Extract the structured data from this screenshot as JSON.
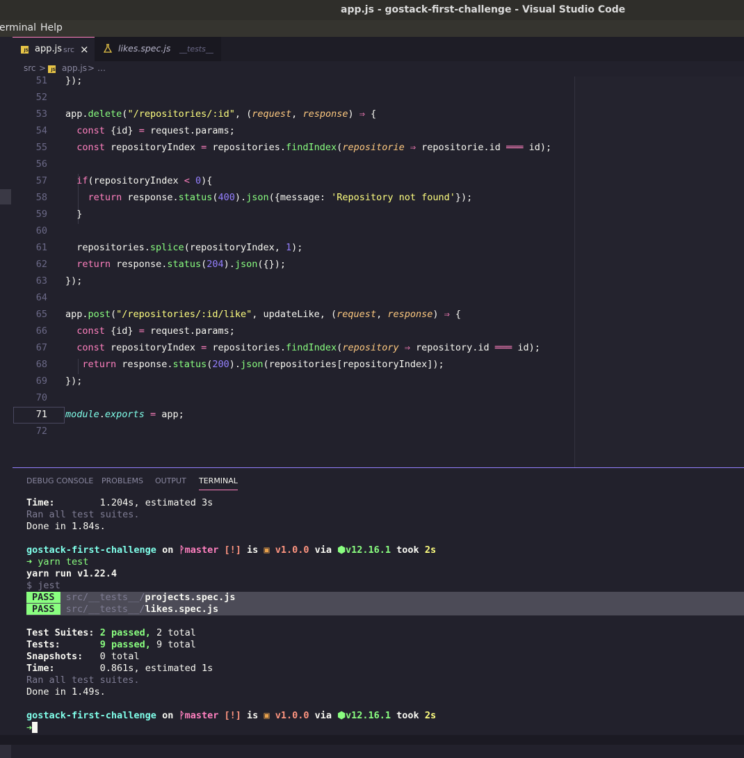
{
  "window": {
    "title": "app.js - gostack-first-challenge - Visual Studio Code"
  },
  "menu": {
    "items": [
      "erminal",
      "Help"
    ]
  },
  "tabs": [
    {
      "filename": "app.js",
      "folder": "src",
      "active": true,
      "close": "×"
    },
    {
      "filename": "likes.spec.js",
      "folder": "__tests__",
      "active": false
    }
  ],
  "breadcrumb": {
    "parts": [
      "src",
      ">",
      "app.js",
      ">",
      "…"
    ]
  },
  "editor": {
    "current_line": 71,
    "lines": [
      51,
      52,
      53,
      54,
      55,
      56,
      57,
      58,
      59,
      60,
      61,
      62,
      63,
      64,
      65,
      66,
      67,
      68,
      69,
      70,
      71,
      72
    ]
  },
  "panel": {
    "tabs": [
      "DEBUG CONSOLE",
      "PROBLEMS",
      "OUTPUT",
      "TERMINAL"
    ],
    "active_tab": "TERMINAL"
  },
  "terminal": {
    "prev_time_label": "Time:",
    "prev_time_value": "1.204s, estimated 3s",
    "prev_ran": "Ran all test suites.",
    "prev_done": "Done in 1.84s.",
    "prompt": {
      "dir": "gostack-first-challenge",
      "on": "on",
      "branch": "master",
      "status": "[!]",
      "is": "is",
      "version": "v1.0.0",
      "via": "via",
      "node": "v12.16.1",
      "took": "took",
      "duration": "2s"
    },
    "arrow": "➜",
    "command": "yarn test",
    "yarn_run": "yarn run v1.22.4",
    "jest_cmd": "$ jest",
    "results": [
      {
        "badge": "PASS",
        "path": "src/__tests__/",
        "file": "projects.spec.js"
      },
      {
        "badge": "PASS",
        "path": "src/__tests__/",
        "file": "likes.spec.js"
      }
    ],
    "summary": {
      "suites_label": "Test Suites:",
      "suites_passed": "2 passed,",
      "suites_total": "2 total",
      "tests_label": "Tests:",
      "tests_passed": "9 passed,",
      "tests_total": "9 total",
      "snap_label": "Snapshots:",
      "snap_value": "0 total",
      "time_label": "Time:",
      "time_value": "0.861s, estimated 1s"
    },
    "ran": "Ran all test suites.",
    "done": "Done in 1.49s."
  },
  "colors": {
    "background": "#22212c",
    "pink": "#ff80bf",
    "green": "#8aff80",
    "cyan": "#80ffea",
    "yellow": "#ffff80",
    "purple": "#9580ff",
    "orange": "#ffca80"
  },
  "icons": [
    "js-file-icon",
    "test-flask-icon",
    "close-icon",
    "git-branch-icon",
    "package-icon",
    "node-hex-icon",
    "arrow-prompt-icon"
  ]
}
